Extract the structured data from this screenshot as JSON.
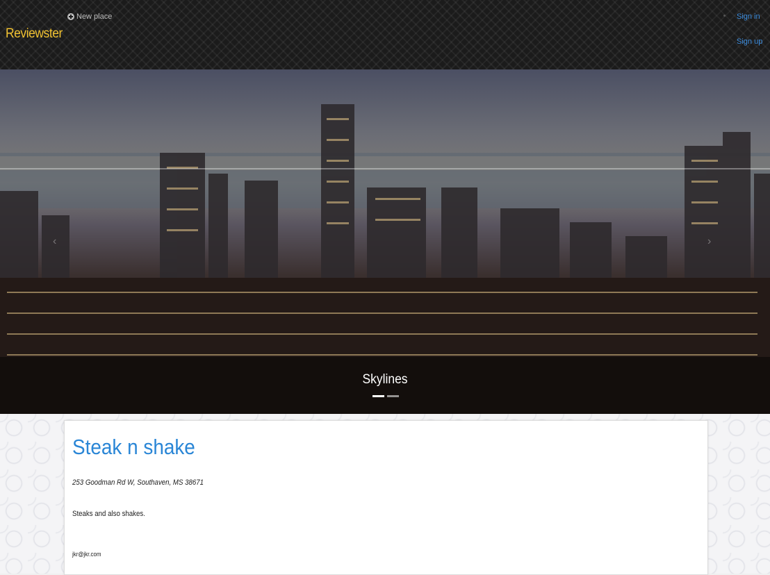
{
  "navbar": {
    "brand": "Reviewster",
    "new_place_label": "New place",
    "sign_in_label": "Sign in",
    "sign_up_label": "Sign up"
  },
  "carousel": {
    "caption": "Skylines",
    "slide_count": 2,
    "active_slide": 1
  },
  "place": {
    "name": "Steak n shake",
    "address": "253 Goodman Rd W, Southaven, MS 38671",
    "description": "Steaks and also shakes.",
    "email": "jkr@jkr.com"
  },
  "colors": {
    "brand": "#f1c232",
    "link": "#3d8ee0",
    "title": "#2a86d6"
  }
}
